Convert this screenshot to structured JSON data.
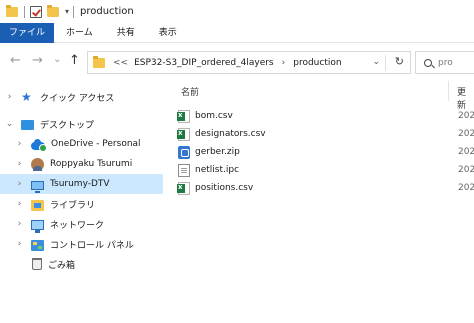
{
  "window": {
    "title": "production",
    "qa_dropdown": "▾"
  },
  "ribbon": {
    "tabs": [
      "ファイル",
      "ホーム",
      "共有",
      "表示"
    ]
  },
  "nav": {
    "back": "←",
    "forward": "→",
    "recent": "⌄",
    "up": "↑"
  },
  "address": {
    "overflow": "<<",
    "crumbs": [
      "ESP32-S3_DIP_ordered_4layers",
      "production"
    ],
    "separator": "›",
    "dropdown": "⌄",
    "refresh": "↻"
  },
  "search": {
    "placeholder": "pro"
  },
  "sidebar": {
    "items": [
      {
        "label": "クイック アクセス",
        "icon": "star-icon",
        "chevron": "›",
        "selected": false
      },
      {
        "label": "デスクトップ",
        "icon": "desktop-icon",
        "chevron": "⌄",
        "selected": false
      },
      {
        "label": "OneDrive - Personal",
        "icon": "onedrive-icon",
        "chevron": "›",
        "selected": false
      },
      {
        "label": "Roppyaku Tsurumi",
        "icon": "user-icon",
        "chevron": "›",
        "selected": false
      },
      {
        "label": "Tsurumy-DTV",
        "icon": "computer-icon",
        "chevron": "›",
        "selected": true
      },
      {
        "label": "ライブラリ",
        "icon": "library-icon",
        "chevron": "›",
        "selected": false
      },
      {
        "label": "ネットワーク",
        "icon": "network-icon",
        "chevron": "›",
        "selected": false
      },
      {
        "label": "コントロール パネル",
        "icon": "control-panel-icon",
        "chevron": "›",
        "selected": false
      },
      {
        "label": "ごみ箱",
        "icon": "recycle-bin-icon",
        "chevron": "",
        "selected": false
      }
    ]
  },
  "columns": {
    "name": "名前",
    "modified": "更新"
  },
  "files": [
    {
      "name": "bom.csv",
      "icon": "excel-csv-icon",
      "date": "202"
    },
    {
      "name": "designators.csv",
      "icon": "excel-csv-icon",
      "date": "202"
    },
    {
      "name": "gerber.zip",
      "icon": "zip-icon",
      "date": "202"
    },
    {
      "name": "netlist.ipc",
      "icon": "document-icon",
      "date": "202"
    },
    {
      "name": "positions.csv",
      "icon": "excel-csv-icon",
      "date": "202"
    }
  ],
  "colors": {
    "file_tab": "#1a5fb4",
    "selected_item": "#cce8ff",
    "folder": "#f3c64b"
  }
}
